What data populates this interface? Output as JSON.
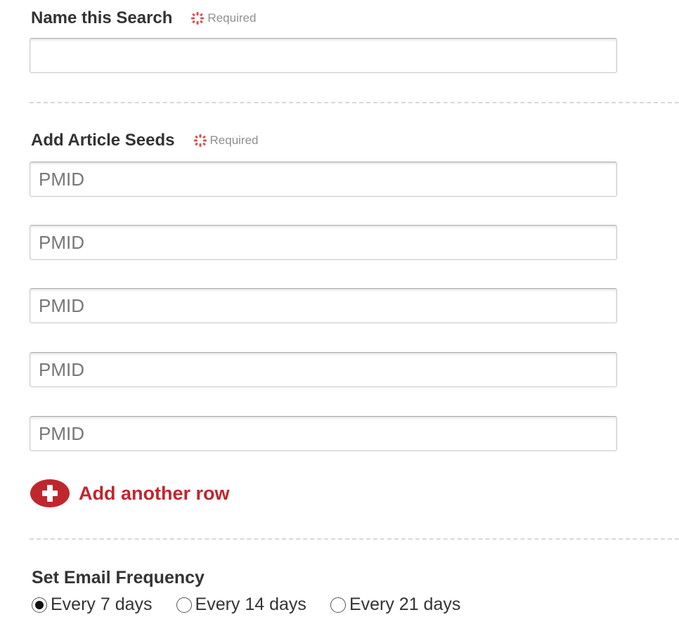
{
  "name_section": {
    "title": "Name this Search",
    "required_label": "Required",
    "input_value": "",
    "input_placeholder": ""
  },
  "seeds_section": {
    "title": "Add Article Seeds",
    "required_label": "Required",
    "inputs": [
      {
        "placeholder": "PMID",
        "value": ""
      },
      {
        "placeholder": "PMID",
        "value": ""
      },
      {
        "placeholder": "PMID",
        "value": ""
      },
      {
        "placeholder": "PMID",
        "value": ""
      },
      {
        "placeholder": "PMID",
        "value": ""
      }
    ],
    "add_row_label": "Add another row"
  },
  "frequency_section": {
    "title": "Set Email Frequency",
    "options": [
      {
        "label": "Every 7 days",
        "selected": true
      },
      {
        "label": "Every 14 days",
        "selected": false
      },
      {
        "label": "Every 21 days",
        "selected": false
      }
    ]
  },
  "colors": {
    "accent": "#c0262d",
    "required_icon": "#d9534f",
    "text": "#333333",
    "muted": "#8f8f8f"
  },
  "icons": {
    "required": "asterisk-icon",
    "add_row": "plus-circle-icon",
    "radio_selected": "radio-checked-icon",
    "radio_unselected": "radio-unchecked-icon"
  }
}
